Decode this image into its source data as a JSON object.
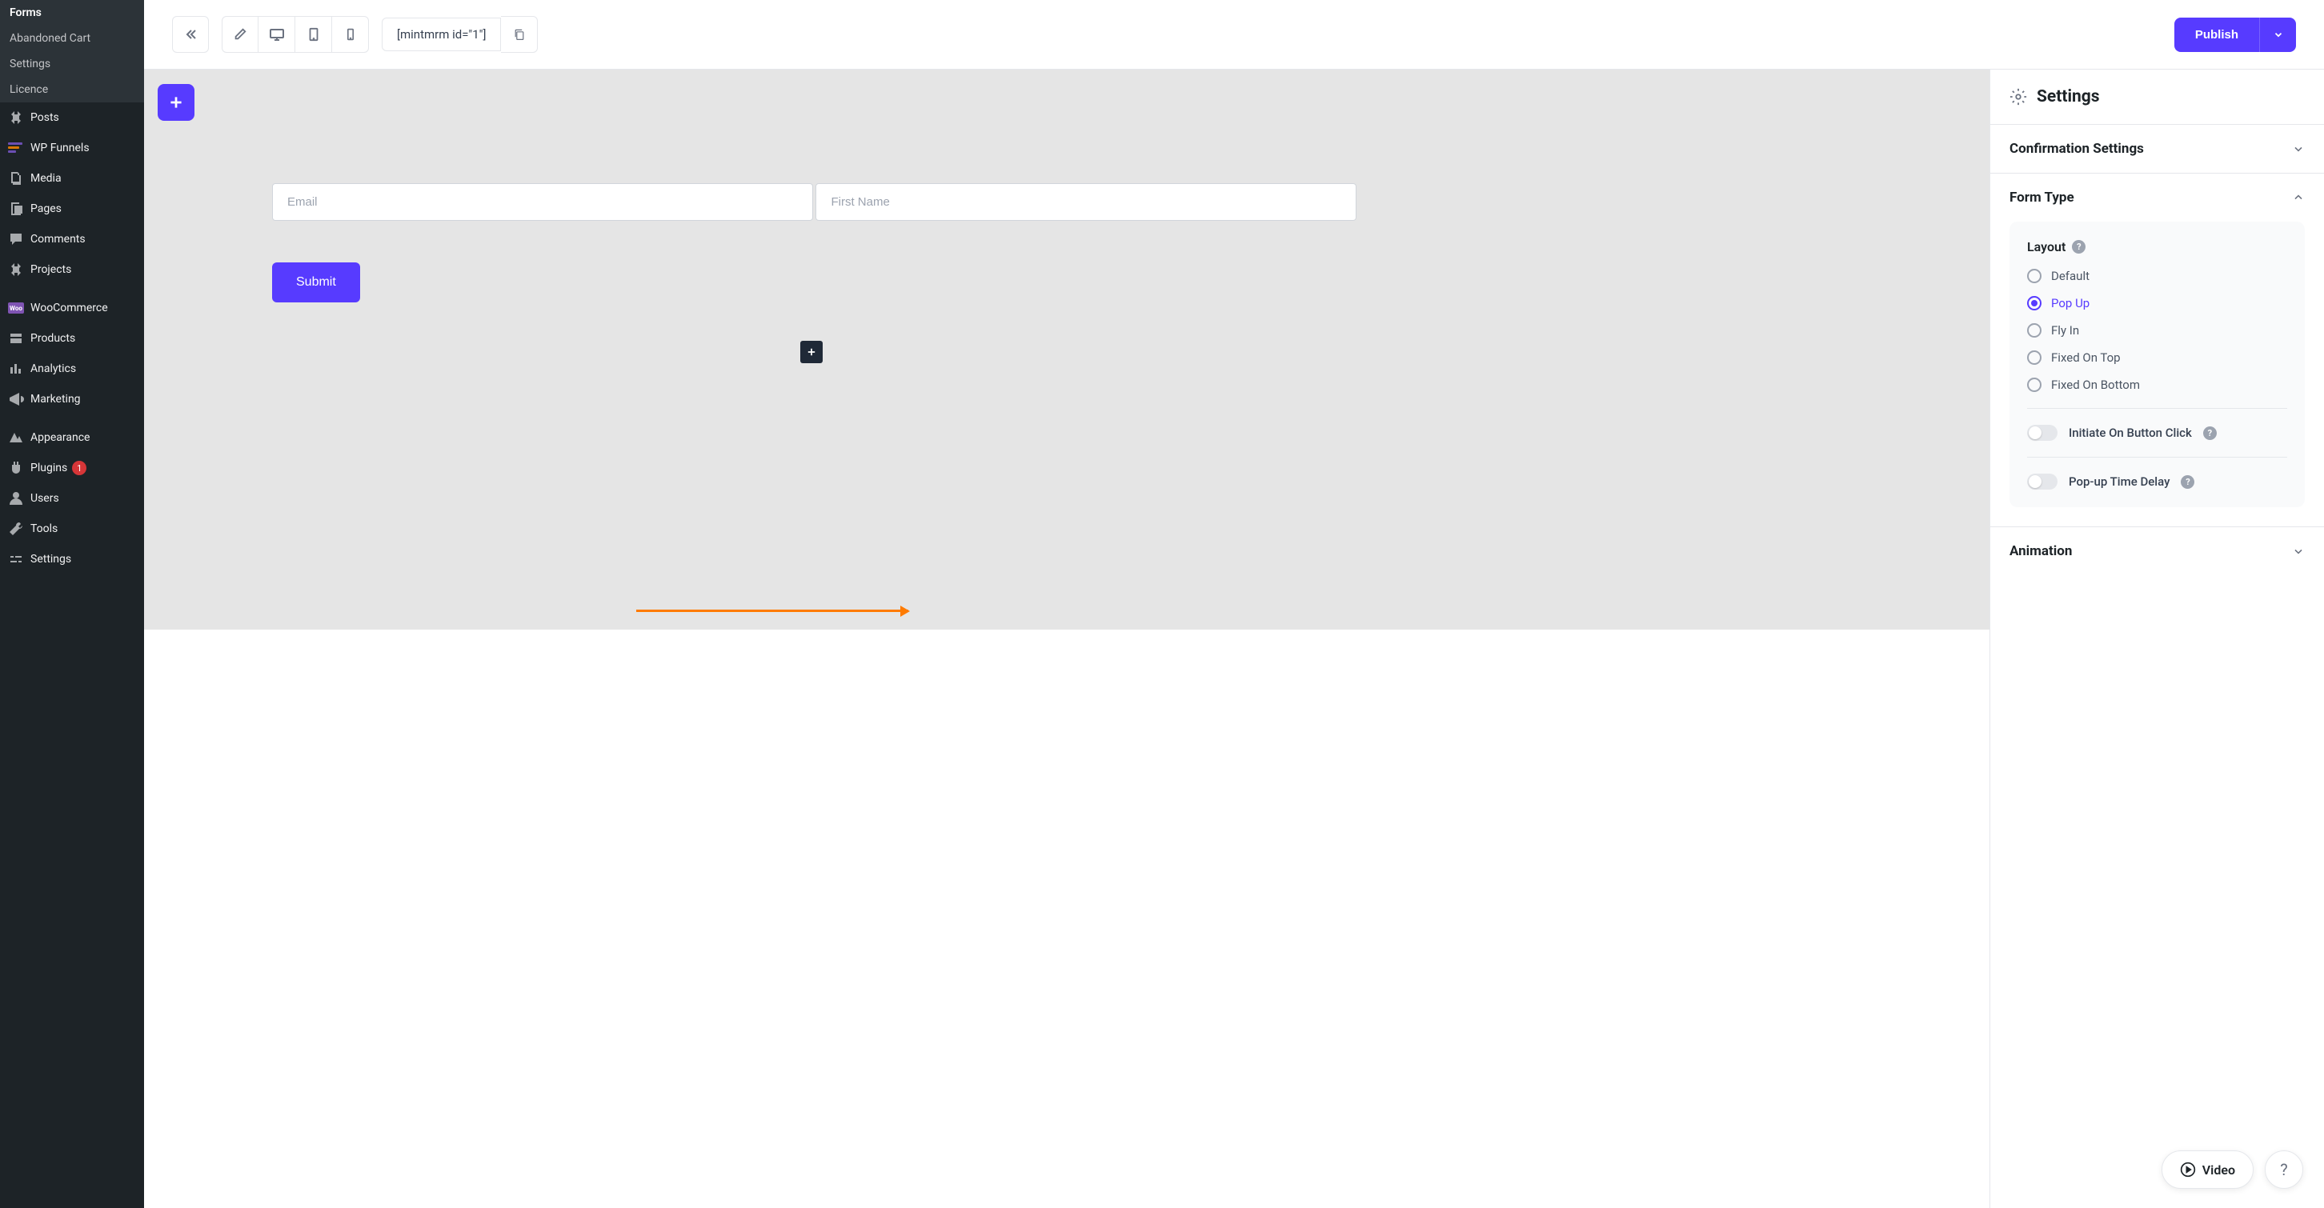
{
  "sidebar": {
    "submenu": [
      {
        "label": "Forms",
        "active": true
      },
      {
        "label": "Abandoned Cart",
        "active": false
      },
      {
        "label": "Settings",
        "active": false
      },
      {
        "label": "Licence",
        "active": false
      }
    ],
    "items": [
      {
        "label": "Posts",
        "icon": "pin"
      },
      {
        "label": "WP Funnels",
        "icon": "funnels"
      },
      {
        "label": "Media",
        "icon": "media"
      },
      {
        "label": "Pages",
        "icon": "pages"
      },
      {
        "label": "Comments",
        "icon": "comments"
      },
      {
        "label": "Projects",
        "icon": "pin"
      },
      {
        "label": "WooCommerce",
        "icon": "woo"
      },
      {
        "label": "Products",
        "icon": "products"
      },
      {
        "label": "Analytics",
        "icon": "analytics"
      },
      {
        "label": "Marketing",
        "icon": "marketing"
      },
      {
        "label": "Appearance",
        "icon": "appearance"
      },
      {
        "label": "Plugins",
        "icon": "plugins",
        "badge": "1"
      },
      {
        "label": "Users",
        "icon": "users"
      },
      {
        "label": "Tools",
        "icon": "tools"
      },
      {
        "label": "Settings",
        "icon": "settings"
      }
    ]
  },
  "topbar": {
    "shortcode": "[mintmrm id=\"1\"]",
    "publish_label": "Publish"
  },
  "form": {
    "email_placeholder": "Email",
    "firstname_placeholder": "First Name",
    "submit_label": "Submit"
  },
  "panel": {
    "title": "Settings",
    "confirmation_title": "Confirmation Settings",
    "formtype_title": "Form Type",
    "layout_label": "Layout",
    "layout_options": [
      {
        "label": "Default",
        "selected": false
      },
      {
        "label": "Pop Up",
        "selected": true
      },
      {
        "label": "Fly In",
        "selected": false
      },
      {
        "label": "Fixed On Top",
        "selected": false
      },
      {
        "label": "Fixed On Bottom",
        "selected": false
      }
    ],
    "initiate_label": "Initiate On Button Click",
    "delay_label": "Pop-up Time Delay",
    "animation_title": "Animation"
  },
  "float": {
    "video_label": "Video"
  }
}
